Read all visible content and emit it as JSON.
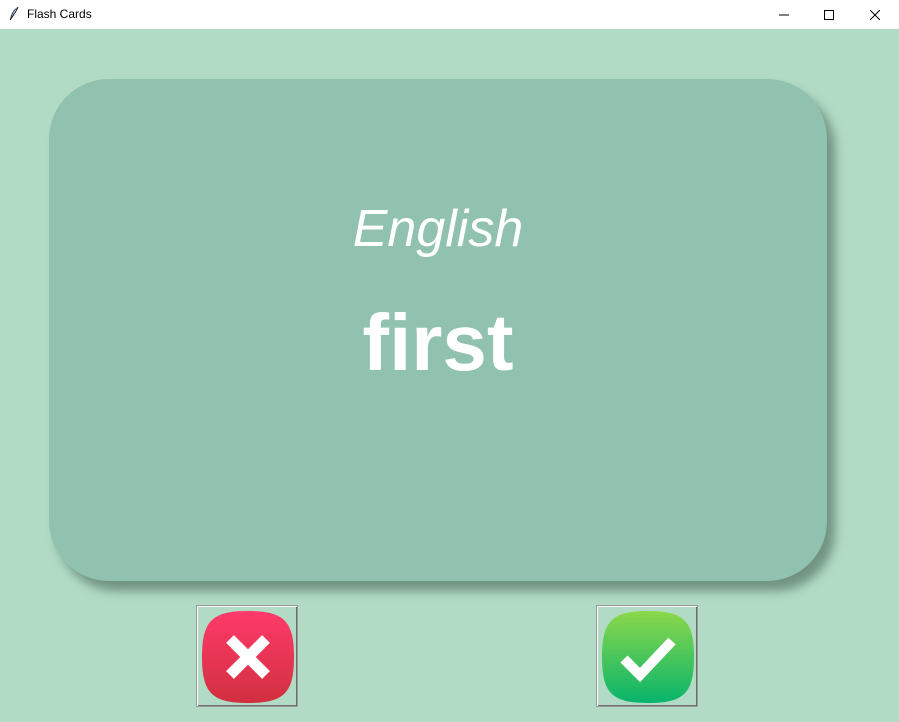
{
  "window": {
    "title": "Flash Cards",
    "controls": [
      "minimize",
      "maximize",
      "close"
    ]
  },
  "card": {
    "language": "English",
    "word": "first",
    "background_color": "#91c1af"
  },
  "buttons": {
    "wrong": {
      "icon": "x-icon",
      "color": "#e8305a"
    },
    "right": {
      "icon": "check-icon",
      "color": "#2ecc5f"
    }
  },
  "colors": {
    "window_background": "#b1dbc5"
  }
}
